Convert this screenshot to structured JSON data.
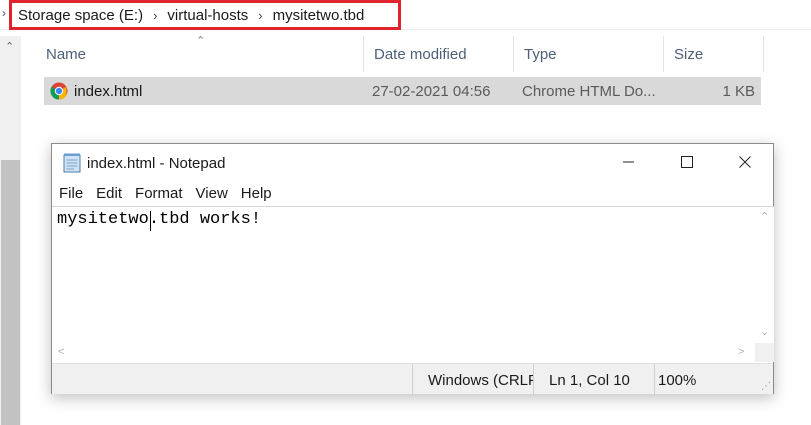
{
  "breadcrumb": {
    "items": [
      "Storage space (E:)",
      "virtual-hosts",
      "mysitetwo.tbd"
    ],
    "highlight_color": "#e0242d"
  },
  "explorer": {
    "columns": {
      "name": "Name",
      "date": "Date modified",
      "type": "Type",
      "size": "Size"
    },
    "files": [
      {
        "icon": "chrome-icon",
        "name": "index.html",
        "date": "27-02-2021 04:56",
        "type": "Chrome HTML Do...",
        "size": "1 KB",
        "selected": true
      }
    ]
  },
  "notepad": {
    "title": "index.html - Notepad",
    "menu": [
      "File",
      "Edit",
      "Format",
      "View",
      "Help"
    ],
    "content": "mysitetwo.tbd works!",
    "status": {
      "line_ending": "Windows (CRLF)",
      "position": "Ln 1, Col 10",
      "zoom": "100%"
    }
  }
}
